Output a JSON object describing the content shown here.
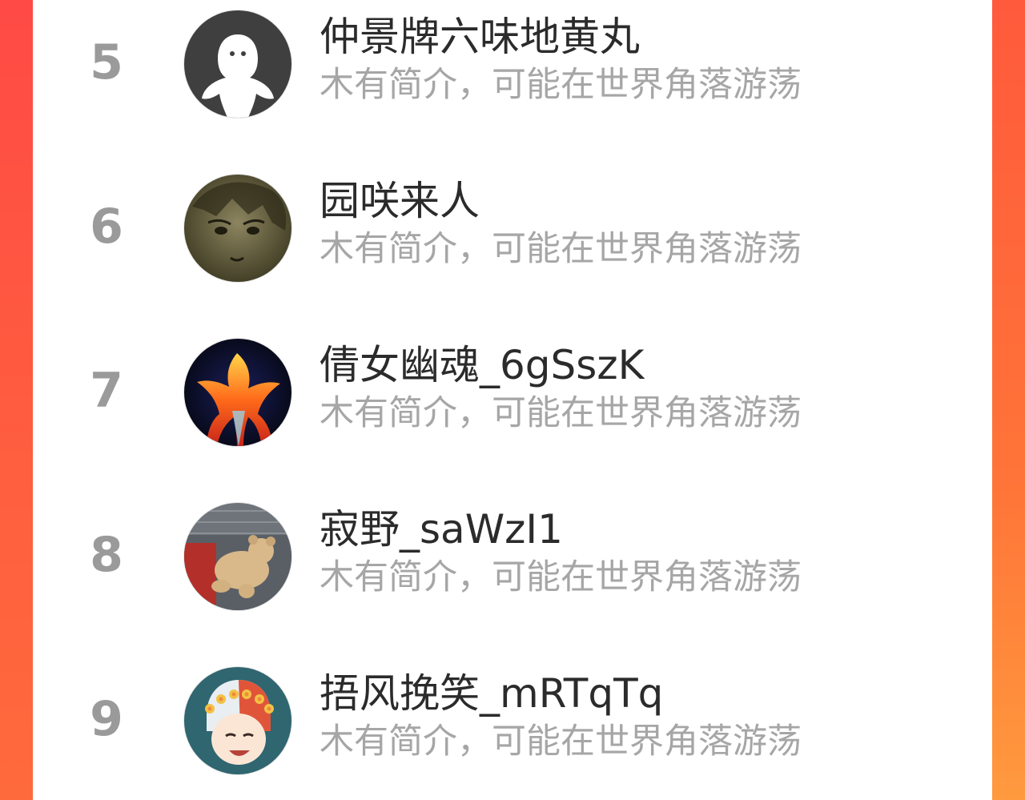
{
  "ranking": {
    "items": [
      {
        "rank": "5",
        "name": "仲景牌六味地黄丸",
        "bio": "木有简介，可能在世界角落游荡",
        "avatar_icon": "default-ghost-avatar-icon"
      },
      {
        "rank": "6",
        "name": "园咲来人",
        "bio": "木有简介，可能在世界角落游荡",
        "avatar_icon": "anime-character-avatar-icon"
      },
      {
        "rank": "7",
        "name": "倩女幽魂_6gSszK",
        "bio": "木有简介，可能在世界角落游荡",
        "avatar_icon": "phoenix-flame-avatar-icon"
      },
      {
        "rank": "8",
        "name": "寂野_saWzI1",
        "bio": "木有简介，可能在世界角落游荡",
        "avatar_icon": "teddy-bear-avatar-icon"
      },
      {
        "rank": "9",
        "name": "捂风挽笑_mRTqTq",
        "bio": "木有简介，可能在世界角落游荡",
        "avatar_icon": "flower-crown-anime-avatar-icon"
      }
    ]
  },
  "colors": {
    "background_left": "#ff4a45",
    "background_right": "#ff7438",
    "panel": "#ffffff",
    "rank_number": "#9a9a9a",
    "name_text": "#2b2b2b",
    "bio_text": "#a6a6a6"
  }
}
